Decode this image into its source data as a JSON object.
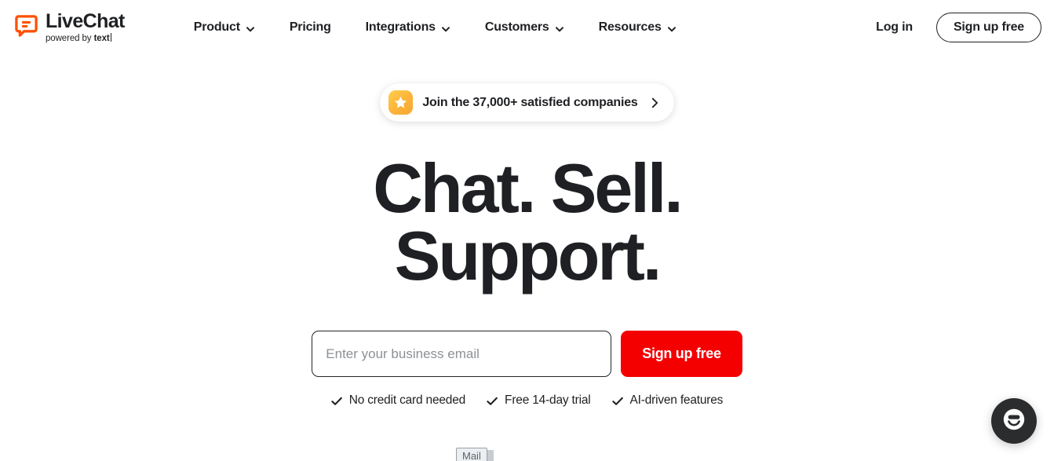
{
  "header": {
    "logo": {
      "wordmark": "LiveChat",
      "powered_prefix": "powered by ",
      "powered_brand": "text",
      "icon": "livechat-speech-bubble-icon",
      "accent_color": "#FF5100"
    },
    "nav": [
      {
        "label": "Product",
        "has_dropdown": true
      },
      {
        "label": "Pricing",
        "has_dropdown": false
      },
      {
        "label": "Integrations",
        "has_dropdown": true
      },
      {
        "label": "Customers",
        "has_dropdown": true
      },
      {
        "label": "Resources",
        "has_dropdown": true
      }
    ],
    "login_label": "Log in",
    "signup_label": "Sign up free"
  },
  "hero": {
    "badge": {
      "text": "Join the 37,000+ satisfied companies",
      "icon": "star-icon",
      "arrow_icon": "chevron-right-icon",
      "icon_color": "#FBB33A"
    },
    "headline_line1": "Chat. Sell.",
    "headline_line2": "Support.",
    "form": {
      "email_placeholder": "Enter your business email",
      "email_value": "",
      "submit_label": "Sign up free",
      "submit_color": "#F50000"
    },
    "benefits": [
      "No credit card needed",
      "Free 14-day trial",
      "AI-driven features"
    ]
  },
  "bottom_peek": {
    "mail_label": "Mail"
  },
  "chat_widget": {
    "icon": "chat-smiley-icon",
    "background_color": "#2B2C2E"
  }
}
